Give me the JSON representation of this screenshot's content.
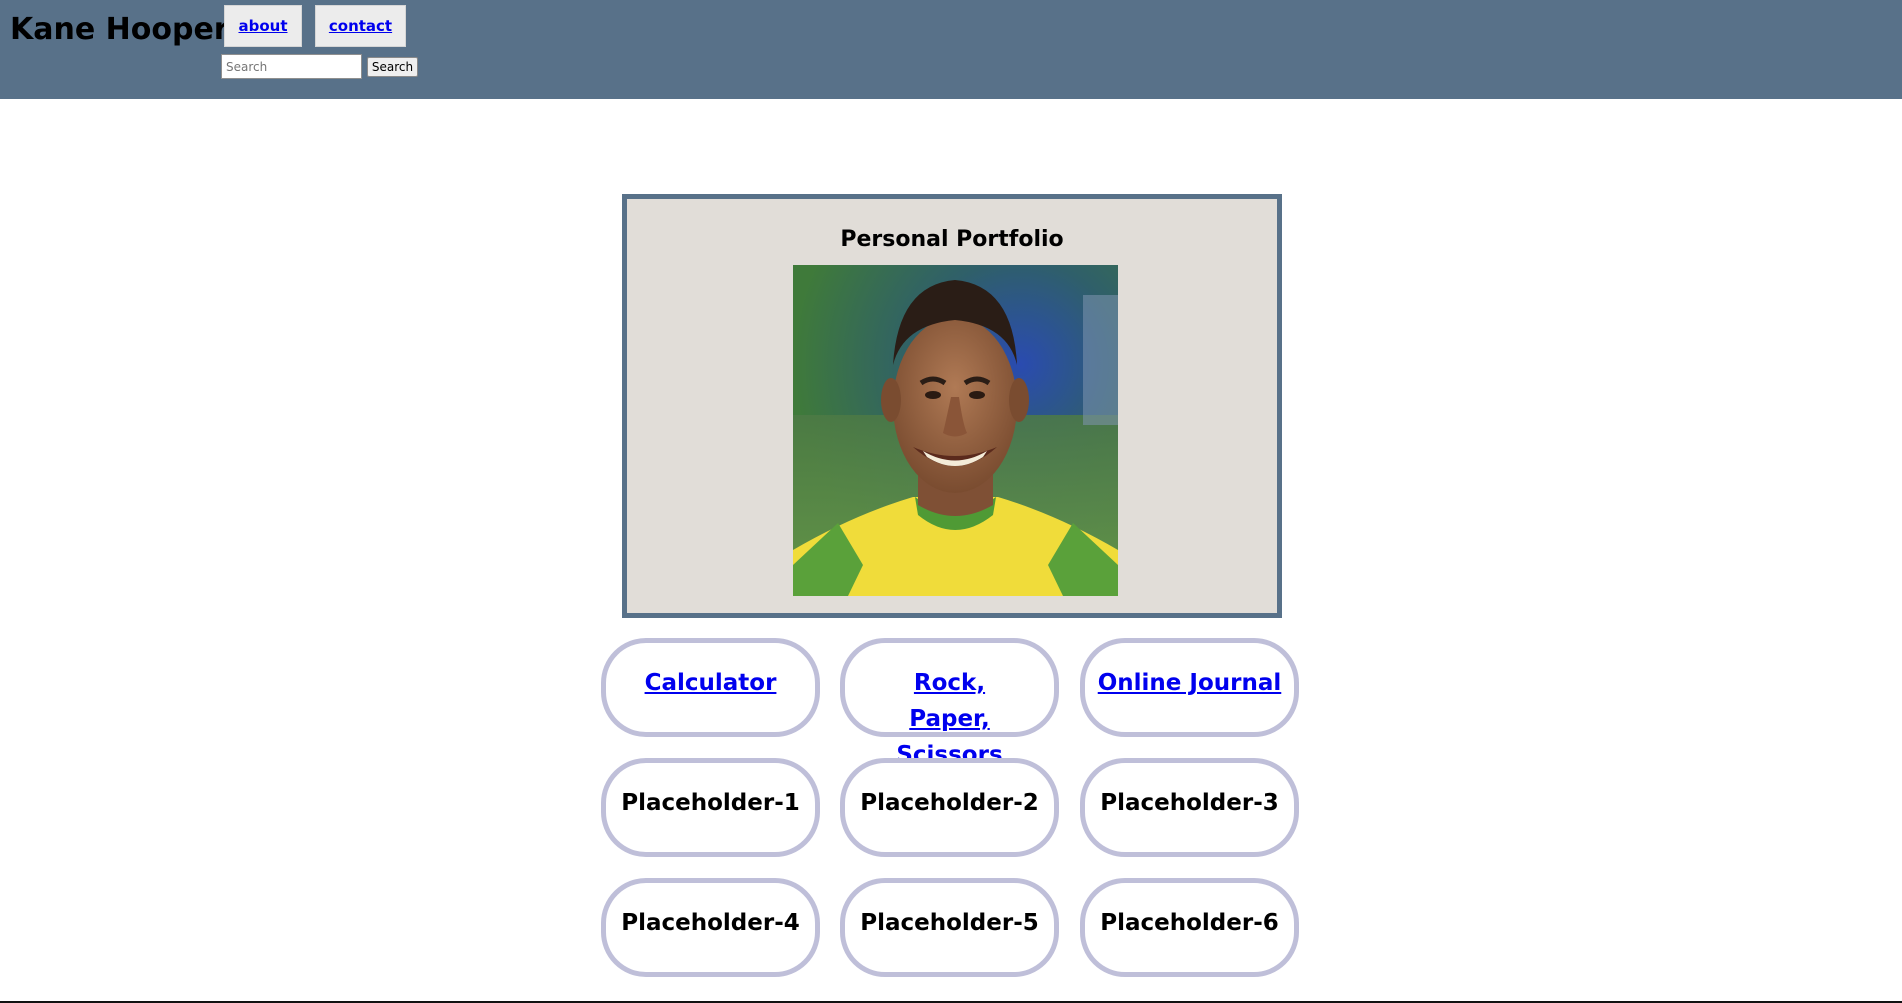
{
  "header": {
    "site_name": "Kane Hooper",
    "nav": [
      {
        "label": "about"
      },
      {
        "label": "contact"
      }
    ],
    "search": {
      "placeholder": "Search",
      "value": "",
      "button_label": "Search"
    },
    "background_color": "#587189"
  },
  "portfolio": {
    "title": "Personal Portfolio",
    "border_color": "#587189",
    "background_color": "#e1ddd8"
  },
  "projects": [
    {
      "label": "Calculator",
      "link": true
    },
    {
      "label": "Rock, Paper, Scissors",
      "link": true
    },
    {
      "label": "Online Journal",
      "link": true
    },
    {
      "label": "Placeholder-1",
      "link": false
    },
    {
      "label": "Placeholder-2",
      "link": false
    },
    {
      "label": "Placeholder-3",
      "link": false
    },
    {
      "label": "Placeholder-4",
      "link": false
    },
    {
      "label": "Placeholder-5",
      "link": false
    },
    {
      "label": "Placeholder-6",
      "link": false
    }
  ],
  "colors": {
    "link": "#0000ee",
    "tile_border": "#bfbfd9"
  }
}
